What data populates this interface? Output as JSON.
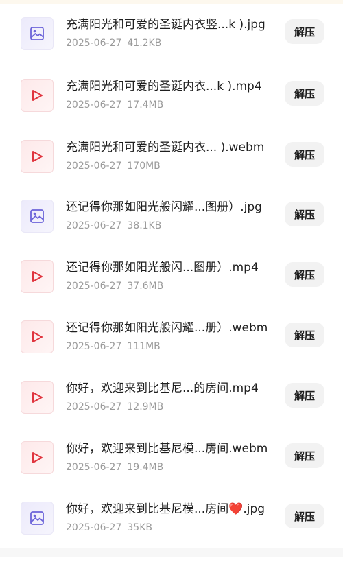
{
  "files": [
    {
      "type": "image",
      "icon": "image-icon",
      "name": "充满阳光和可爱的圣诞内衣竖...k ).jpg",
      "date": "2025-06-27",
      "size": "41.2KB",
      "action": "解压"
    },
    {
      "type": "video",
      "icon": "play-icon",
      "name": "充满阳光和可爱的圣诞内衣...k ).mp4",
      "date": "2025-06-27",
      "size": "17.4MB",
      "action": "解压"
    },
    {
      "type": "video",
      "icon": "play-icon",
      "name": "充满阳光和可爱的圣诞内衣... ).webm",
      "date": "2025-06-27",
      "size": "170MB",
      "action": "解压"
    },
    {
      "type": "image",
      "icon": "image-icon",
      "name": "还记得你那如阳光般闪耀...图册）.jpg",
      "date": "2025-06-27",
      "size": "38.1KB",
      "action": "解压"
    },
    {
      "type": "video",
      "icon": "play-icon",
      "name": "还记得你那如阳光般闪...图册）.mp4",
      "date": "2025-06-27",
      "size": "37.6MB",
      "action": "解压"
    },
    {
      "type": "video",
      "icon": "play-icon",
      "name": "还记得你那如阳光般闪耀...册）.webm",
      "date": "2025-06-27",
      "size": "111MB",
      "action": "解压"
    },
    {
      "type": "video",
      "icon": "play-icon",
      "name": "你好，欢迎来到比基尼...的房间.mp4",
      "date": "2025-06-27",
      "size": "12.9MB",
      "action": "解压"
    },
    {
      "type": "video",
      "icon": "play-icon",
      "name": "你好，欢迎来到比基尼模...房间.webm",
      "date": "2025-06-27",
      "size": "19.4MB",
      "action": "解压"
    },
    {
      "type": "image",
      "icon": "image-icon",
      "name": "你好，欢迎来到比基尼模...房间❤️.jpg",
      "date": "2025-06-27",
      "size": "35KB",
      "action": "解压"
    }
  ],
  "colors": {
    "image_icon": "#6b63d9",
    "video_icon": "#e0353f",
    "button_bg": "#f2f2f2",
    "meta_text": "#9b9b9b"
  }
}
